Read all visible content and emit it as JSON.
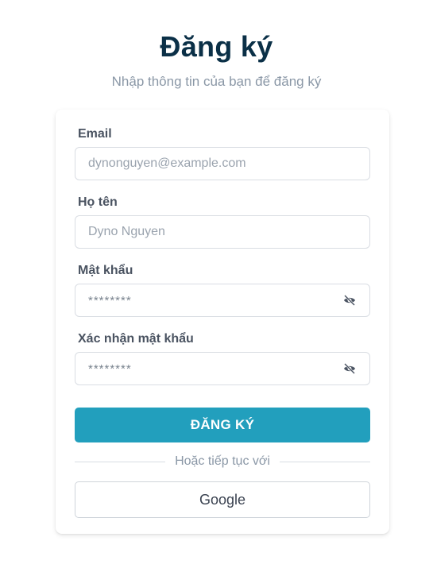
{
  "header": {
    "title": "Đăng ký",
    "subtitle": "Nhập thông tin của bạn để đăng ký"
  },
  "form": {
    "email": {
      "label": "Email",
      "placeholder": "dynonguyen@example.com"
    },
    "name": {
      "label": "Họ tên",
      "placeholder": "Dyno Nguyen"
    },
    "password": {
      "label": "Mật khẩu",
      "placeholder": "********",
      "icon": "eye-off-icon"
    },
    "confirm": {
      "label": "Xác nhận mật khẩu",
      "placeholder": "********",
      "icon": "eye-off-icon"
    },
    "submit_label": "ĐĂNG KÝ",
    "divider_text": "Hoặc tiếp tục với",
    "google_label": "Google"
  },
  "colors": {
    "primary": "#229fbd",
    "title": "#0b3047",
    "muted": "#8a97a6"
  }
}
